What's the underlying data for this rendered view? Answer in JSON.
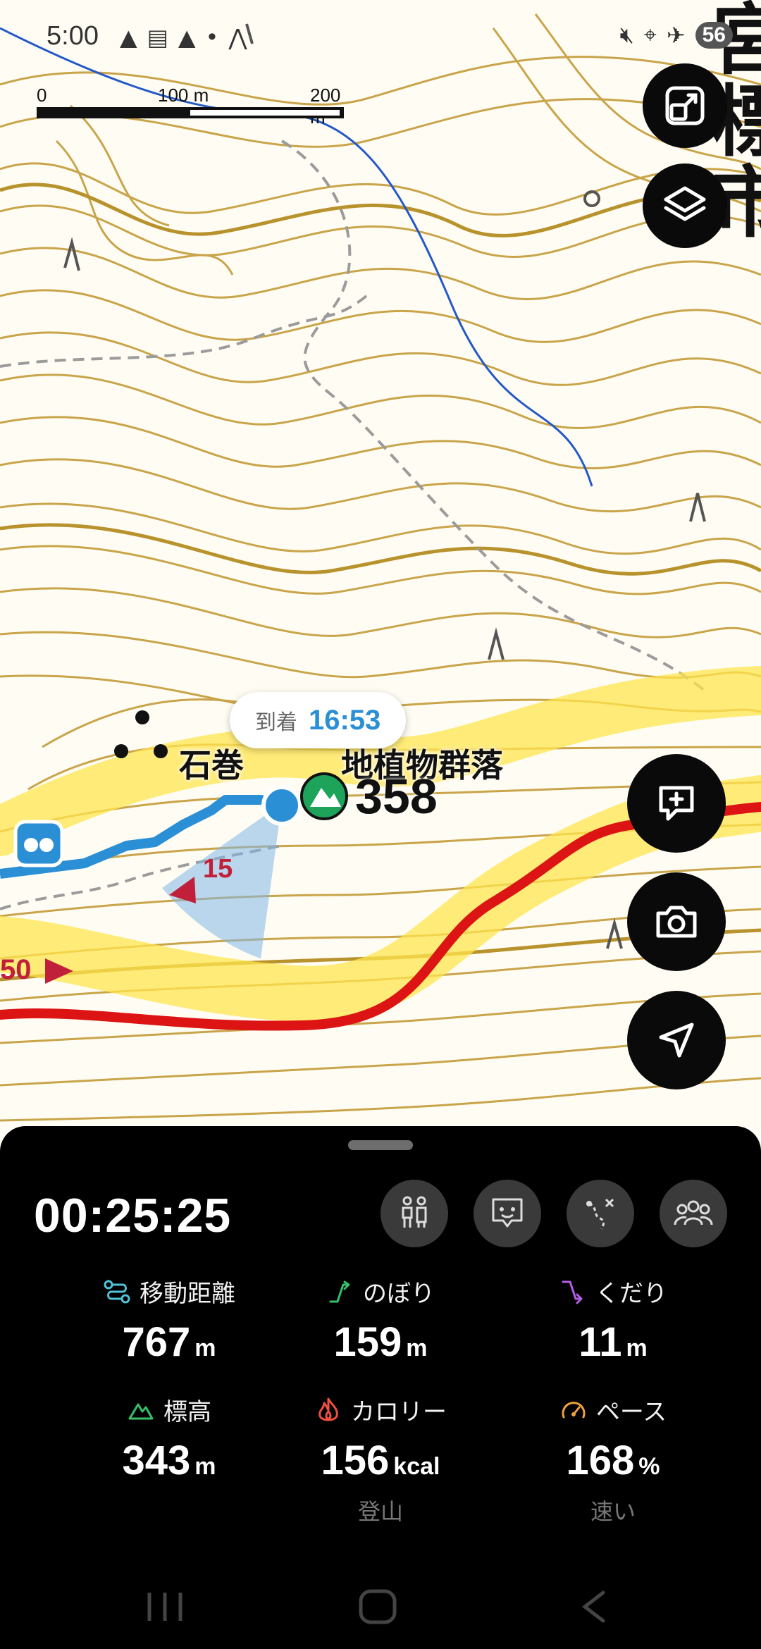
{
  "status_bar": {
    "time": "5:00",
    "battery": "56",
    "left_icons": [
      "warning-icon",
      "notes-icon",
      "warning-icon",
      "dot-icon",
      "wifi-icon"
    ],
    "right_icons": [
      "mute-icon",
      "location-icon",
      "airplane-icon"
    ]
  },
  "map": {
    "scale": {
      "label_0": "0",
      "label_100": "100 m",
      "label_200": "200 m"
    },
    "place_label": "石巻　　　地植物群落",
    "peak_height": "358",
    "arrival": {
      "label": "到着",
      "time": "16:53"
    },
    "slope_label": "15",
    "route_label": "50",
    "city_label": "宮標市",
    "colors": {
      "route_red": "#dc1414",
      "track_blue": "#2b8fd6",
      "contour": "#c9a44a",
      "heat_yellow": "#ffe44d"
    },
    "fab_icons": [
      "fullscreen-icon",
      "layers-icon",
      "add-memo-icon",
      "camera-icon",
      "navigate-icon"
    ]
  },
  "sheet": {
    "timer": "00:25:25",
    "tools": [
      "restroom-icon",
      "memo-icon",
      "route-icon",
      "group-icon"
    ],
    "stats": {
      "distance": {
        "label": "移動距離",
        "value": "767",
        "unit": "m",
        "icon": "distance-icon",
        "color": "#4fc3d9"
      },
      "ascent": {
        "label": "のぼり",
        "value": "159",
        "unit": "m",
        "icon": "ascent-icon",
        "color": "#37c06a"
      },
      "descent": {
        "label": "くだり",
        "value": "11",
        "unit": "m",
        "icon": "descent-icon",
        "color": "#b45ee8"
      },
      "elevation": {
        "label": "標高",
        "value": "343",
        "unit": "m",
        "icon": "mountain-icon",
        "color": "#37c06a"
      },
      "calories": {
        "label": "カロリー",
        "value": "156",
        "unit": "kcal",
        "sub": "登山",
        "icon": "flame-icon",
        "color": "#f0503c"
      },
      "pace": {
        "label": "ペース",
        "value": "168",
        "unit": "%",
        "sub": "速い",
        "icon": "speedometer-icon",
        "color": "#f0a23c"
      }
    }
  },
  "navbar": {
    "icons": [
      "recents-icon",
      "home-icon",
      "back-icon"
    ]
  }
}
